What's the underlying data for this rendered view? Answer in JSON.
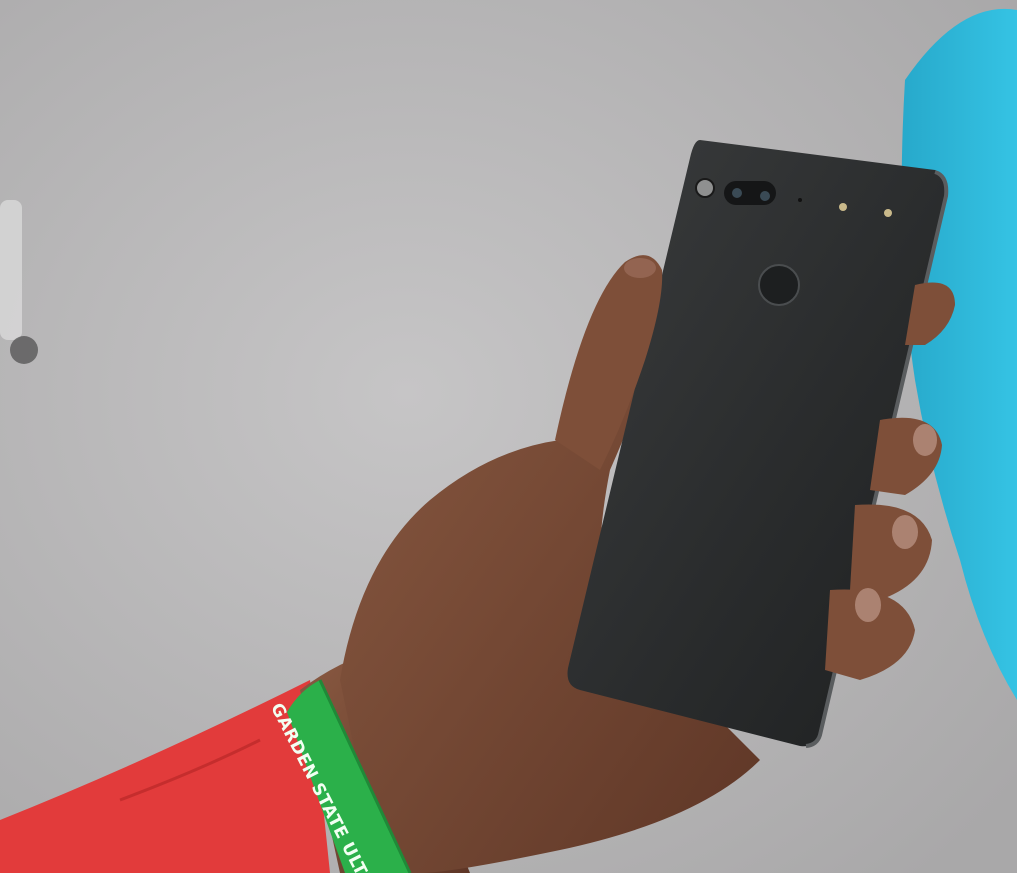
{
  "wristband": {
    "text": "GARDEN STATE ULTIMATE"
  },
  "colors": {
    "background": "#bdbcbd",
    "phone_body": "#2a2c2d",
    "skin": "#7a4a35",
    "sleeve": "#e23b3b",
    "wristband": "#2bb04a",
    "cushion": "#2bb6d6"
  }
}
